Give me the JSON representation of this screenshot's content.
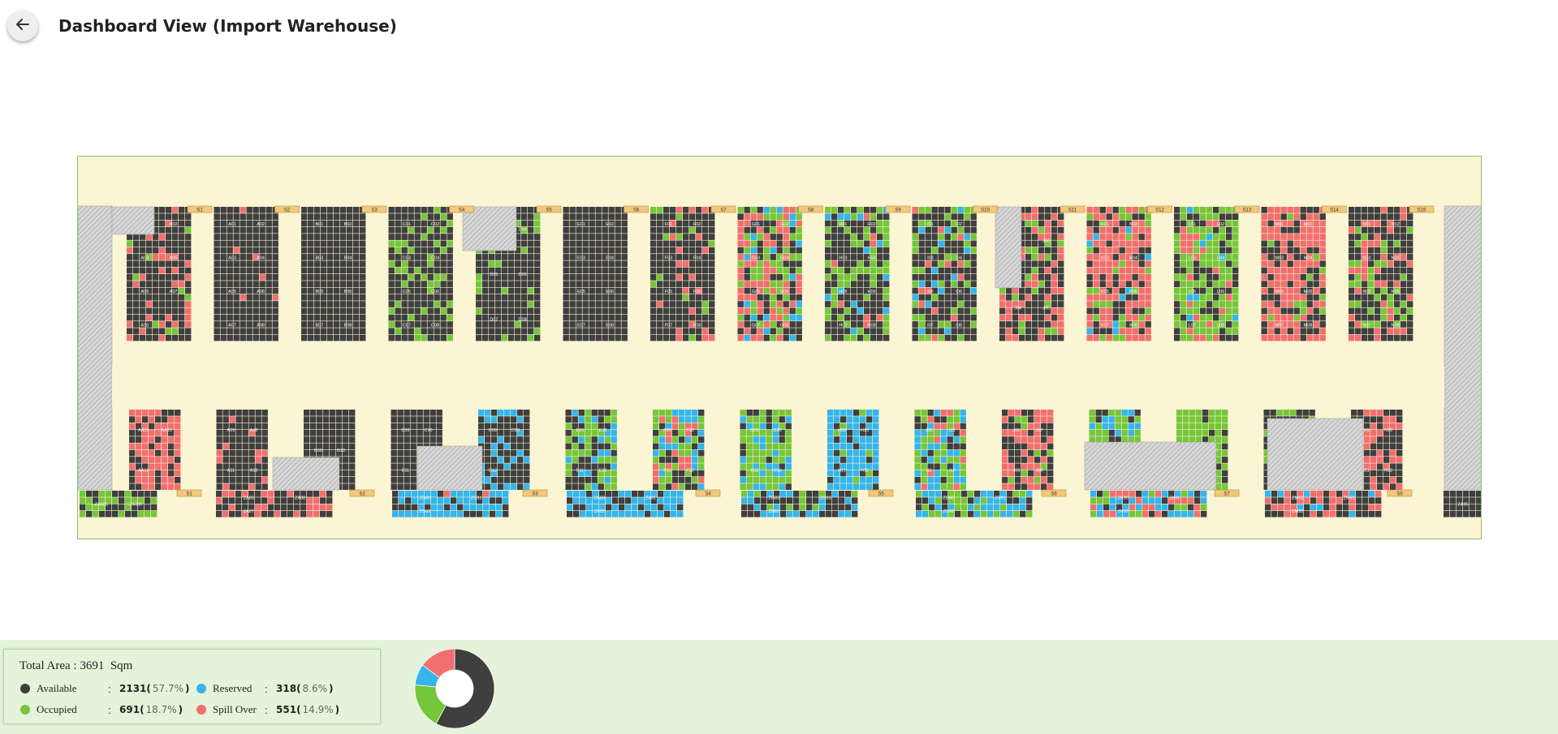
{
  "header": {
    "title": "Dashboard View (Import Warehouse)",
    "back_icon": "arrow-left-icon"
  },
  "colors": {
    "available": "#3f3f3f",
    "occupied": "#76c63b",
    "reserved": "#35b5ec",
    "spill_over": "#f26f6f",
    "floor": "#fbf5d3",
    "blocked": "#d6d6d6",
    "label_tag": "#f3c77c"
  },
  "summary": {
    "total_area_label": "Total Area : 3691  Sqm",
    "items": [
      {
        "key": "available",
        "label": "Available",
        "sep": ":",
        "value": "2131",
        "open": " (",
        "pct": "57.7%",
        "close": ")",
        "color": "#3f3f3f"
      },
      {
        "key": "occupied",
        "label": "Occupied",
        "sep": ":",
        "value": "691",
        "open": " (",
        "pct": "18.7%",
        "close": ")",
        "color": "#76c63b"
      },
      {
        "key": "reserved",
        "label": "Reserved",
        "sep": ":",
        "value": "318",
        "open": " (",
        "pct": "8.6%",
        "close": ")",
        "color": "#35b5ec"
      },
      {
        "key": "spill_over",
        "label": "Spill Over",
        "sep": ":",
        "value": "551",
        "open": " (",
        "pct": "14.9%",
        "close": ")",
        "color": "#f26f6f"
      }
    ]
  },
  "chart_data": {
    "type": "pie",
    "donut": true,
    "categories": [
      "Available",
      "Occupied",
      "Reserved",
      "Spill Over"
    ],
    "values": [
      2131,
      691,
      318,
      551
    ],
    "colors": [
      "#3f3f3f",
      "#76c63b",
      "#35b5ec",
      "#f26f6f"
    ]
  },
  "layout_map": {
    "aisle_top_labels": [
      "S1",
      "S2",
      "S3",
      "S4",
      "S5",
      "S6",
      "S7",
      "S8",
      "S9",
      "S10",
      "S11",
      "S12",
      "S13",
      "S14",
      "S15"
    ],
    "aisle_bottom_labels": [
      "S1",
      "S2",
      "S3",
      "S4",
      "S5",
      "S6",
      "S7",
      "S8"
    ],
    "upper_blocks": [
      {
        "id": "A",
        "labels": [
          "A01",
          "A02",
          "A03",
          "A05",
          "A06",
          "A07",
          "A10"
        ],
        "mix": [
          0.75,
          0.05,
          0,
          0.2
        ]
      },
      {
        "id": "B",
        "labels": [
          "A01",
          "A02",
          "A03",
          "A04",
          "A05",
          "A06",
          "A07",
          "A08"
        ],
        "mix": [
          0.95,
          0,
          0,
          0.05
        ]
      },
      {
        "id": "C",
        "labels": [
          "B01",
          "B02",
          "B03",
          "B04",
          "B05",
          "B06",
          "B07",
          "B08"
        ],
        "mix": [
          1,
          0,
          0,
          0
        ]
      },
      {
        "id": "D",
        "labels": [
          "C01",
          "C02",
          "C03",
          "C04",
          "C05",
          "C06",
          "C07",
          "C08"
        ],
        "mix": [
          0.75,
          0.25,
          0,
          0
        ]
      },
      {
        "id": "E",
        "labels": [
          "D03",
          "D04",
          "D05",
          "D06",
          "D07",
          "D08"
        ],
        "mix": [
          0.9,
          0.1,
          0,
          0
        ]
      },
      {
        "id": "F",
        "labels": [
          "E01",
          "E02",
          "E03",
          "E04",
          "E05",
          "E06",
          "E07",
          "E08"
        ],
        "mix": [
          1,
          0,
          0,
          0
        ]
      },
      {
        "id": "G",
        "labels": [
          "F01",
          "F02",
          "F03",
          "F04",
          "F05",
          "F06",
          "F07",
          "F08"
        ],
        "mix": [
          0.8,
          0.1,
          0,
          0.1
        ]
      },
      {
        "id": "H",
        "labels": [
          "G01",
          "G02",
          "G03",
          "G04",
          "G05",
          "G06",
          "G07",
          "G08"
        ],
        "mix": [
          0.3,
          0.3,
          0.1,
          0.3
        ]
      },
      {
        "id": "I",
        "labels": [
          "H01",
          "H02",
          "H03",
          "H04",
          "H05",
          "H06",
          "H07",
          "H08"
        ],
        "mix": [
          0.5,
          0.35,
          0.1,
          0.05
        ]
      },
      {
        "id": "J",
        "labels": [
          "I01",
          "I02",
          "I03",
          "I04",
          "I05",
          "I06",
          "I07",
          "I08"
        ],
        "mix": [
          0.65,
          0.2,
          0.1,
          0.05
        ]
      },
      {
        "id": "K",
        "labels": [
          "J02",
          "J03",
          "J04",
          "J05"
        ],
        "mix": [
          0.55,
          0.1,
          0,
          0.35
        ]
      },
      {
        "id": "L",
        "labels": [
          "K01",
          "K02",
          "K03",
          "K04",
          "K05",
          "K06",
          "K07",
          "K08"
        ],
        "mix": [
          0.25,
          0.15,
          0.05,
          0.55
        ]
      },
      {
        "id": "M",
        "labels": [
          "L01",
          "L02",
          "L03",
          "L04",
          "L05",
          "L06",
          "L07",
          "L08"
        ],
        "mix": [
          0.3,
          0.5,
          0.05,
          0.15
        ]
      },
      {
        "id": "N",
        "labels": [
          "M01",
          "M02",
          "M03",
          "M04",
          "M05",
          "M06",
          "M07",
          "M08"
        ],
        "mix": [
          0.35,
          0.1,
          0,
          0.55
        ]
      },
      {
        "id": "O",
        "labels": [
          "N01",
          "N02",
          "N03",
          "N04",
          "N05",
          "N06",
          "N07",
          "N08"
        ],
        "mix": [
          0.6,
          0.2,
          0,
          0.2
        ]
      }
    ],
    "lower_blocks": [
      {
        "id": "P",
        "labels": [
          "AA14",
          "AA15",
          "AA16"
        ],
        "mix": [
          0.3,
          0,
          0,
          0.7
        ]
      },
      {
        "id": "Q",
        "labels": [
          "A09",
          "A10",
          "A11",
          "A12"
        ],
        "mix": [
          0.9,
          0,
          0,
          0.1
        ]
      },
      {
        "id": "R",
        "labels": [
          "B09",
          "B10"
        ],
        "mix": [
          1,
          0,
          0,
          0
        ]
      },
      {
        "id": "S",
        "labels": [
          "C09",
          "C10",
          "C11"
        ],
        "mix": [
          1,
          0,
          0,
          0
        ]
      },
      {
        "id": "T",
        "labels": [
          "D09",
          "D10",
          "D12"
        ],
        "mix": [
          0.7,
          0,
          0.3,
          0
        ]
      },
      {
        "id": "U",
        "labels": [
          "E09",
          "E10",
          "E11",
          "E12"
        ],
        "mix": [
          0.45,
          0.4,
          0.15,
          0
        ]
      },
      {
        "id": "V",
        "labels": [
          "F09",
          "F10",
          "F11",
          "F12"
        ],
        "mix": [
          0.25,
          0.3,
          0.25,
          0.2
        ]
      },
      {
        "id": "W",
        "labels": [
          "G09",
          "G10",
          "G11",
          "G12"
        ],
        "mix": [
          0.15,
          0.6,
          0.25,
          0
        ]
      },
      {
        "id": "X",
        "labels": [
          "H09",
          "H10",
          "H11",
          "H12"
        ],
        "mix": [
          0.15,
          0.1,
          0.75,
          0
        ]
      },
      {
        "id": "Y",
        "labels": [
          "I09",
          "I10",
          "I11",
          "I12"
        ],
        "mix": [
          0.2,
          0.35,
          0.3,
          0.15
        ]
      },
      {
        "id": "Z",
        "labels": [
          "J06",
          "J07",
          "J08",
          "J09"
        ],
        "mix": [
          0.4,
          0.1,
          0,
          0.5
        ]
      },
      {
        "id": "AA",
        "labels": [
          "K09",
          "K10"
        ],
        "mix": [
          0.15,
          0.6,
          0.25,
          0
        ]
      },
      {
        "id": "AB",
        "labels": [
          "L09",
          "L10"
        ],
        "mix": [
          0.2,
          0.8,
          0,
          0
        ]
      },
      {
        "id": "AC",
        "labels": [
          "M09",
          "M11"
        ],
        "mix": [
          0.5,
          0.4,
          0,
          0.1
        ]
      },
      {
        "id": "AD",
        "labels": [
          "N09",
          "N10",
          "N11",
          "N12"
        ],
        "mix": [
          0.6,
          0,
          0,
          0.4
        ]
      }
    ],
    "bottom_strip_blocks": [
      {
        "labels": [
          "ZA485",
          "ZA486"
        ],
        "mix": [
          0.6,
          0.4,
          0,
          0
        ]
      },
      {
        "labels": [
          "ZA85",
          "ZA88",
          "ZA87"
        ],
        "mix": [
          0.65,
          0,
          0,
          0.35
        ]
      },
      {
        "labels": [
          "ZG90",
          "ZG91",
          "ZG92"
        ],
        "mix": [
          0.35,
          0,
          0.6,
          0.05
        ]
      },
      {
        "labels": [
          "ZA80",
          "ZA81",
          "ZA82"
        ],
        "mix": [
          0.3,
          0,
          0.7,
          0
        ]
      },
      {
        "labels": [
          "ZG83",
          "ZG83",
          "ZG82"
        ],
        "mix": [
          0.5,
          0.25,
          0.25,
          0
        ]
      },
      {
        "labels": [
          "ZG90",
          "ZG91",
          "ZG92"
        ],
        "mix": [
          0.25,
          0.35,
          0.4,
          0
        ]
      },
      {
        "labels": [
          "ZK90",
          "ZK91",
          "ZK92"
        ],
        "mix": [
          0.2,
          0.1,
          0.4,
          0.3
        ]
      },
      {
        "labels": [
          "ZM90",
          "ZM91",
          "ZM92"
        ],
        "mix": [
          0.55,
          0,
          0.15,
          0.3
        ]
      },
      {
        "labels": [
          "ZA95"
        ],
        "mix": [
          1,
          0,
          0,
          0
        ]
      }
    ]
  }
}
